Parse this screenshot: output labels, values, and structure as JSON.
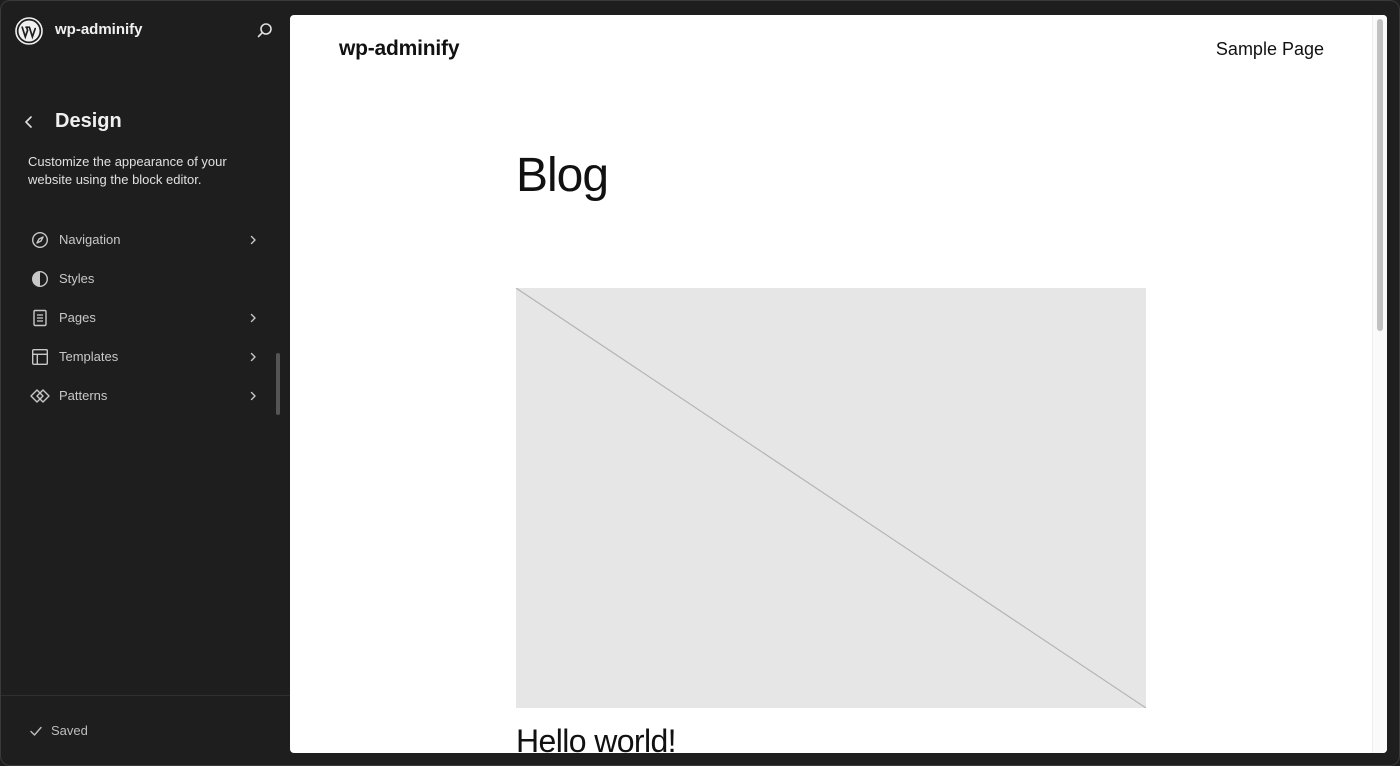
{
  "sidebar": {
    "site_title": "wp-adminify",
    "section_title": "Design",
    "section_description": "Customize the appearance of your website using the block editor.",
    "menu": [
      {
        "label": "Navigation",
        "icon": "navigation-icon",
        "has_submenu": true
      },
      {
        "label": "Styles",
        "icon": "styles-icon",
        "has_submenu": false
      },
      {
        "label": "Pages",
        "icon": "pages-icon",
        "has_submenu": true
      },
      {
        "label": "Templates",
        "icon": "templates-icon",
        "has_submenu": true
      },
      {
        "label": "Patterns",
        "icon": "patterns-icon",
        "has_submenu": true
      }
    ],
    "status": "Saved"
  },
  "canvas": {
    "site_title": "wp-adminify",
    "nav_link": "Sample Page",
    "page_title": "Blog",
    "post_title": "Hello world!"
  },
  "colors": {
    "sidebar_bg": "#1e1e1e",
    "canvas_bg": "#ffffff",
    "placeholder_bg": "#e6e6e6"
  }
}
